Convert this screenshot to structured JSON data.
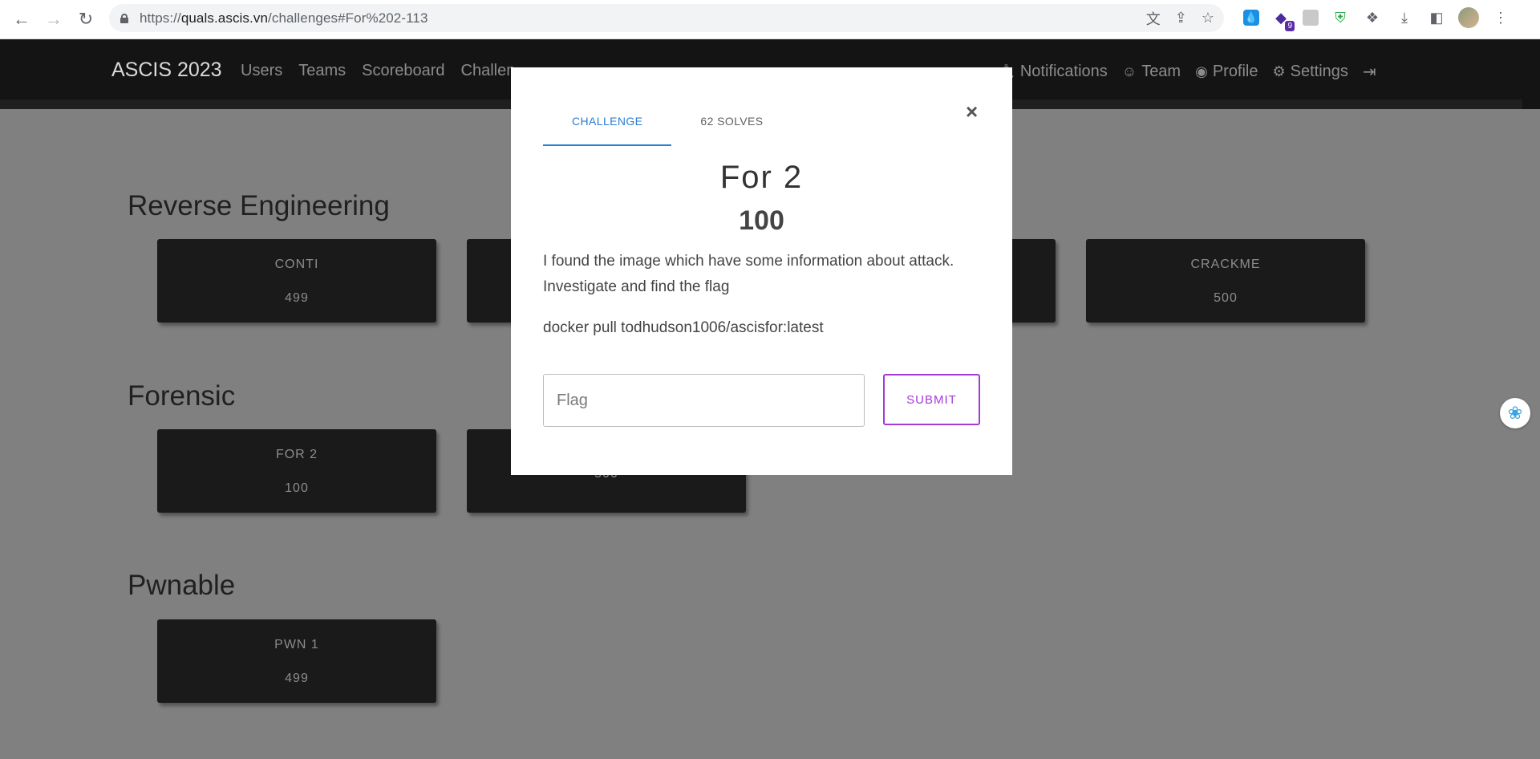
{
  "browser": {
    "url_prefix": "https://",
    "url_host": "quals.ascis.vn",
    "url_path": "/challenges#For%202-113",
    "extension_badge": "9"
  },
  "site_nav": {
    "brand": "ASCIS 2023",
    "links": [
      "Users",
      "Teams",
      "Scoreboard",
      "Challen"
    ],
    "right_links": [
      "Notifications",
      "Team",
      "Profile",
      "Settings"
    ]
  },
  "categories": [
    {
      "title": "Reverse Engineering",
      "challenges": [
        {
          "name": "CONTI",
          "value": "499"
        },
        {
          "name": "CRACKME",
          "value": "500"
        }
      ]
    },
    {
      "title": "Forensic",
      "challenges": [
        {
          "name": "FOR 2",
          "value": "100"
        },
        {
          "name": "",
          "value": "500"
        }
      ]
    },
    {
      "title": "Pwnable",
      "challenges": [
        {
          "name": "PWN 1",
          "value": "499"
        }
      ]
    }
  ],
  "modal": {
    "tab_challenge": "CHALLENGE",
    "tab_solves": "62 SOLVES",
    "close": "×",
    "title": "For 2",
    "value": "100",
    "description": "I found the image which have some information about attack. Investigate and find the flag",
    "command": "docker pull todhudson1006/ascisfor:latest",
    "flag_placeholder": "Flag",
    "submit_label": "SUBMIT"
  },
  "colors": {
    "accent_tab": "#2d7dd2",
    "submit": "#a43ad6",
    "navbar": "#141414",
    "card": "#1a1a1a"
  }
}
